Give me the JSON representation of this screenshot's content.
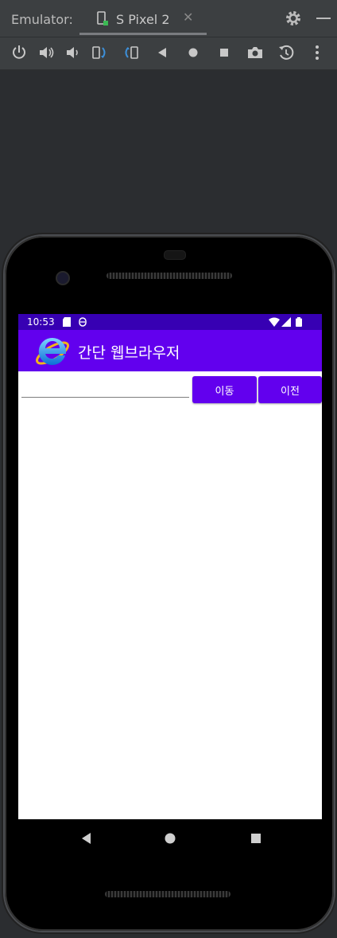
{
  "emulator": {
    "label": "Emulator:",
    "tab_label": "S Pixel 2",
    "tab_close": "✕",
    "toolbar_icons": [
      "power-icon",
      "volume-up-icon",
      "volume-down-icon",
      "rotate-left-icon",
      "rotate-right-icon",
      "back-icon",
      "home-icon",
      "overview-icon",
      "camera-icon",
      "snapshot-icon",
      "more-icon"
    ]
  },
  "status_bar": {
    "time": "10:53",
    "icons": [
      "sd-card-icon",
      "sync-icon",
      "wifi-icon",
      "signal-icon",
      "battery-icon"
    ]
  },
  "app_bar": {
    "title": "간단 웹브라우저",
    "logo": "ie-logo-icon"
  },
  "browser": {
    "url_value": "",
    "go_button": "이동",
    "back_button": "이전"
  },
  "nav_bar": {
    "icons": [
      "nav-back-icon",
      "nav-home-icon",
      "nav-recents-icon"
    ]
  },
  "colors": {
    "primary": "#6200ee",
    "primary_dark": "#3700b3",
    "emulator_bg": "#3c3f41"
  }
}
